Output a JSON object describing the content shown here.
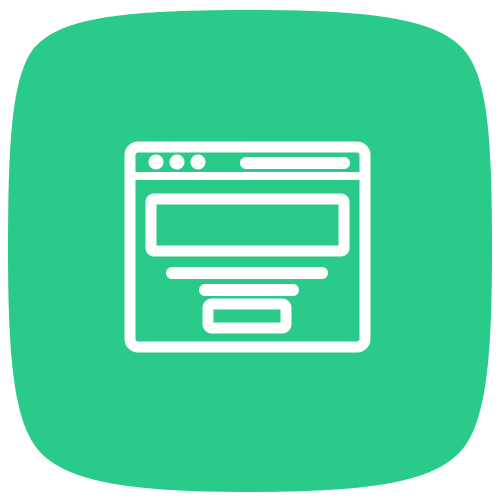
{
  "icon": {
    "name": "browser-window-icon",
    "background_color": "#2ACA8A",
    "foreground_color": "#FFFFFF"
  }
}
